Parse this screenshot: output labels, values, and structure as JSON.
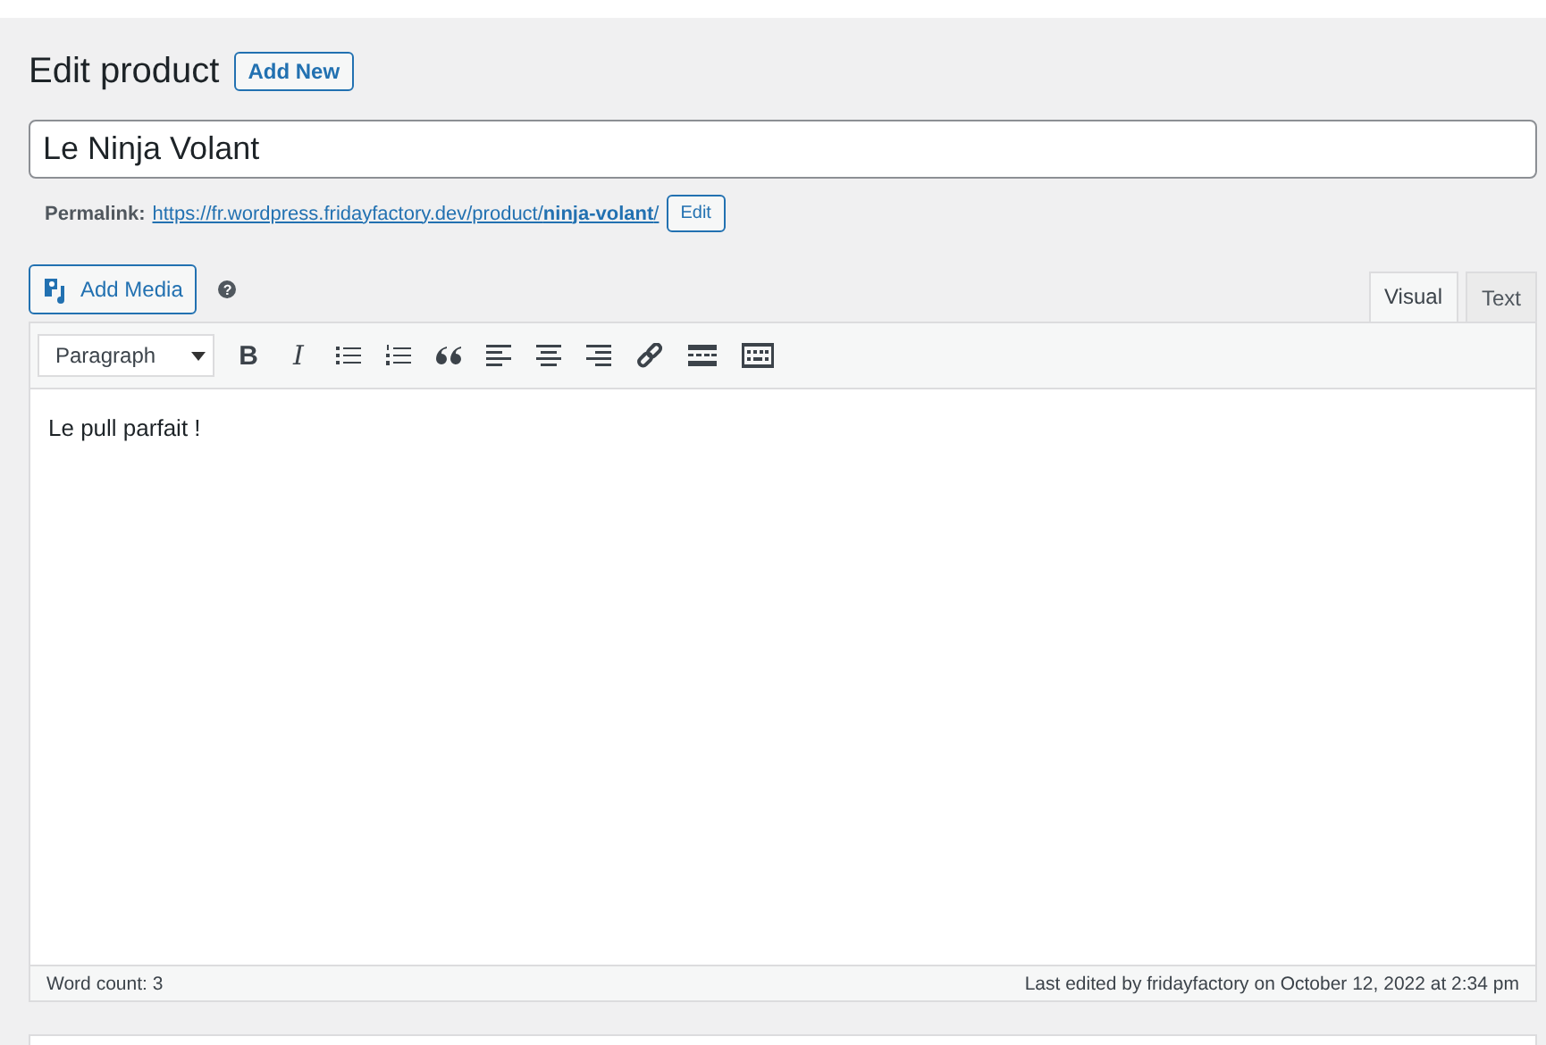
{
  "heading": {
    "title": "Edit product",
    "add_new": "Add New"
  },
  "title_field": {
    "value": "Le Ninja Volant"
  },
  "permalink": {
    "label": "Permalink:",
    "url_base": "https://fr.wordpress.fridayfactory.dev/product/",
    "slug": "ninja-volant",
    "url_end": "/",
    "edit": "Edit"
  },
  "media": {
    "add_media": "Add Media",
    "help": "?"
  },
  "tabs": [
    {
      "label": "Visual",
      "selected": true
    },
    {
      "label": "Text",
      "selected": false
    }
  ],
  "toolbar": {
    "format": "Paragraph",
    "buttons": [
      {
        "kind": "bold",
        "glyph": "B"
      },
      {
        "kind": "italic",
        "glyph": "I"
      },
      {
        "kind": "bullet-list"
      },
      {
        "kind": "numbered-list"
      },
      {
        "kind": "quote"
      },
      {
        "kind": "align-left"
      },
      {
        "kind": "align-center"
      },
      {
        "kind": "align-right"
      },
      {
        "kind": "link"
      },
      {
        "kind": "more"
      },
      {
        "kind": "toolbar-toggle"
      }
    ]
  },
  "content": "Le pull parfait !",
  "status_bar": {
    "word_count": "Word count: 3",
    "last_edited": "Last edited by fridayfactory on October 12, 2022 at 2:34 pm"
  }
}
